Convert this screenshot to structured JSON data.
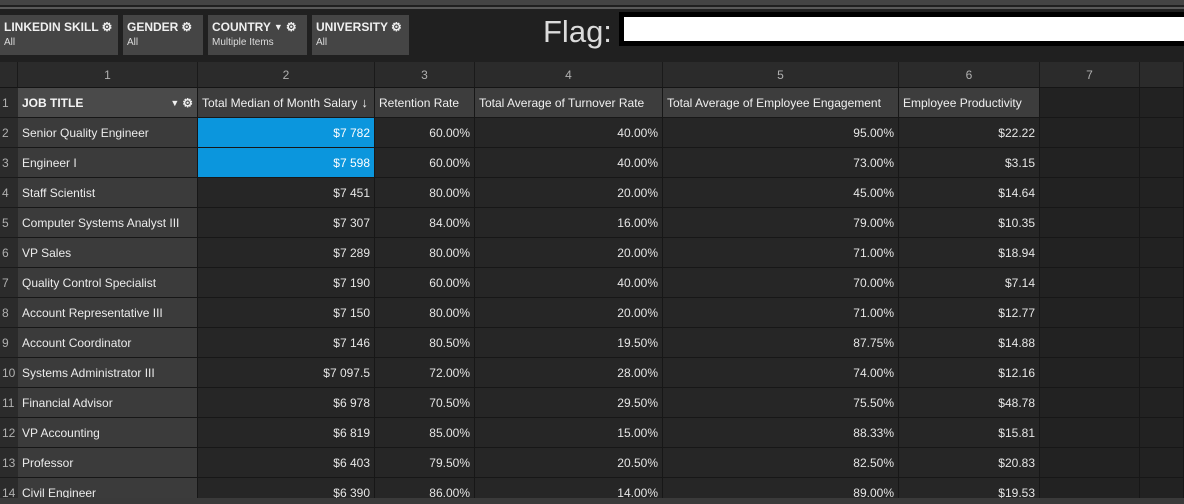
{
  "filters": [
    {
      "name": "LINKEDIN SKILL",
      "value": "All",
      "icons": [
        "gear-icon"
      ]
    },
    {
      "name": "GENDER",
      "value": "All",
      "icons": [
        "gear-icon"
      ]
    },
    {
      "name": "COUNTRY",
      "value": "Multiple Items",
      "icons": [
        "filter-icon",
        "gear-icon"
      ]
    },
    {
      "name": "UNIVERSITY",
      "value": "All",
      "icons": [
        "gear-icon"
      ]
    }
  ],
  "flag": {
    "label": "Flag:",
    "value": ""
  },
  "grid": {
    "column_numbers": [
      "1",
      "2",
      "3",
      "4",
      "5",
      "6",
      "7"
    ],
    "headers": [
      "JOB TITLE",
      "Total Median of Month Salary",
      "Retention Rate",
      "Total Average of Turnover Rate",
      "Total Average of Employee Engagement",
      "Employee Productivity"
    ],
    "sort_indicator": "↓",
    "row_numbers": [
      "1",
      "2",
      "3",
      "4",
      "5",
      "6",
      "7",
      "8",
      "9",
      "10",
      "11",
      "12",
      "13",
      "14"
    ],
    "rows": [
      [
        "Senior Quality Engineer",
        "$7 782",
        "60.00%",
        "40.00%",
        "95.00%",
        "$22.22"
      ],
      [
        "Engineer I",
        "$7 598",
        "60.00%",
        "40.00%",
        "73.00%",
        "$3.15"
      ],
      [
        "Staff Scientist",
        "$7 451",
        "80.00%",
        "20.00%",
        "45.00%",
        "$14.64"
      ],
      [
        "Computer Systems Analyst III",
        "$7 307",
        "84.00%",
        "16.00%",
        "79.00%",
        "$10.35"
      ],
      [
        "VP Sales",
        "$7 289",
        "80.00%",
        "20.00%",
        "71.00%",
        "$18.94"
      ],
      [
        "Quality Control Specialist",
        "$7 190",
        "60.00%",
        "40.00%",
        "70.00%",
        "$7.14"
      ],
      [
        "Account Representative III",
        "$7 150",
        "80.00%",
        "20.00%",
        "71.00%",
        "$12.77"
      ],
      [
        "Account Coordinator",
        "$7 146",
        "80.50%",
        "19.50%",
        "87.75%",
        "$14.88"
      ],
      [
        "Systems Administrator III",
        "$7 097.5",
        "72.00%",
        "28.00%",
        "74.00%",
        "$12.16"
      ],
      [
        "Financial Advisor",
        "$6 978",
        "70.50%",
        "29.50%",
        "75.50%",
        "$48.78"
      ],
      [
        "VP Accounting",
        "$6 819",
        "85.00%",
        "15.00%",
        "88.33%",
        "$15.81"
      ],
      [
        "Professor",
        "$6 403",
        "79.50%",
        "20.50%",
        "82.50%",
        "$20.83"
      ],
      [
        "Civil Engineer",
        "$6 390",
        "86.00%",
        "14.00%",
        "89.00%",
        "$19.53"
      ]
    ],
    "highlighted_rows": [
      0,
      1
    ],
    "highlight_color": "#0b96dd"
  }
}
